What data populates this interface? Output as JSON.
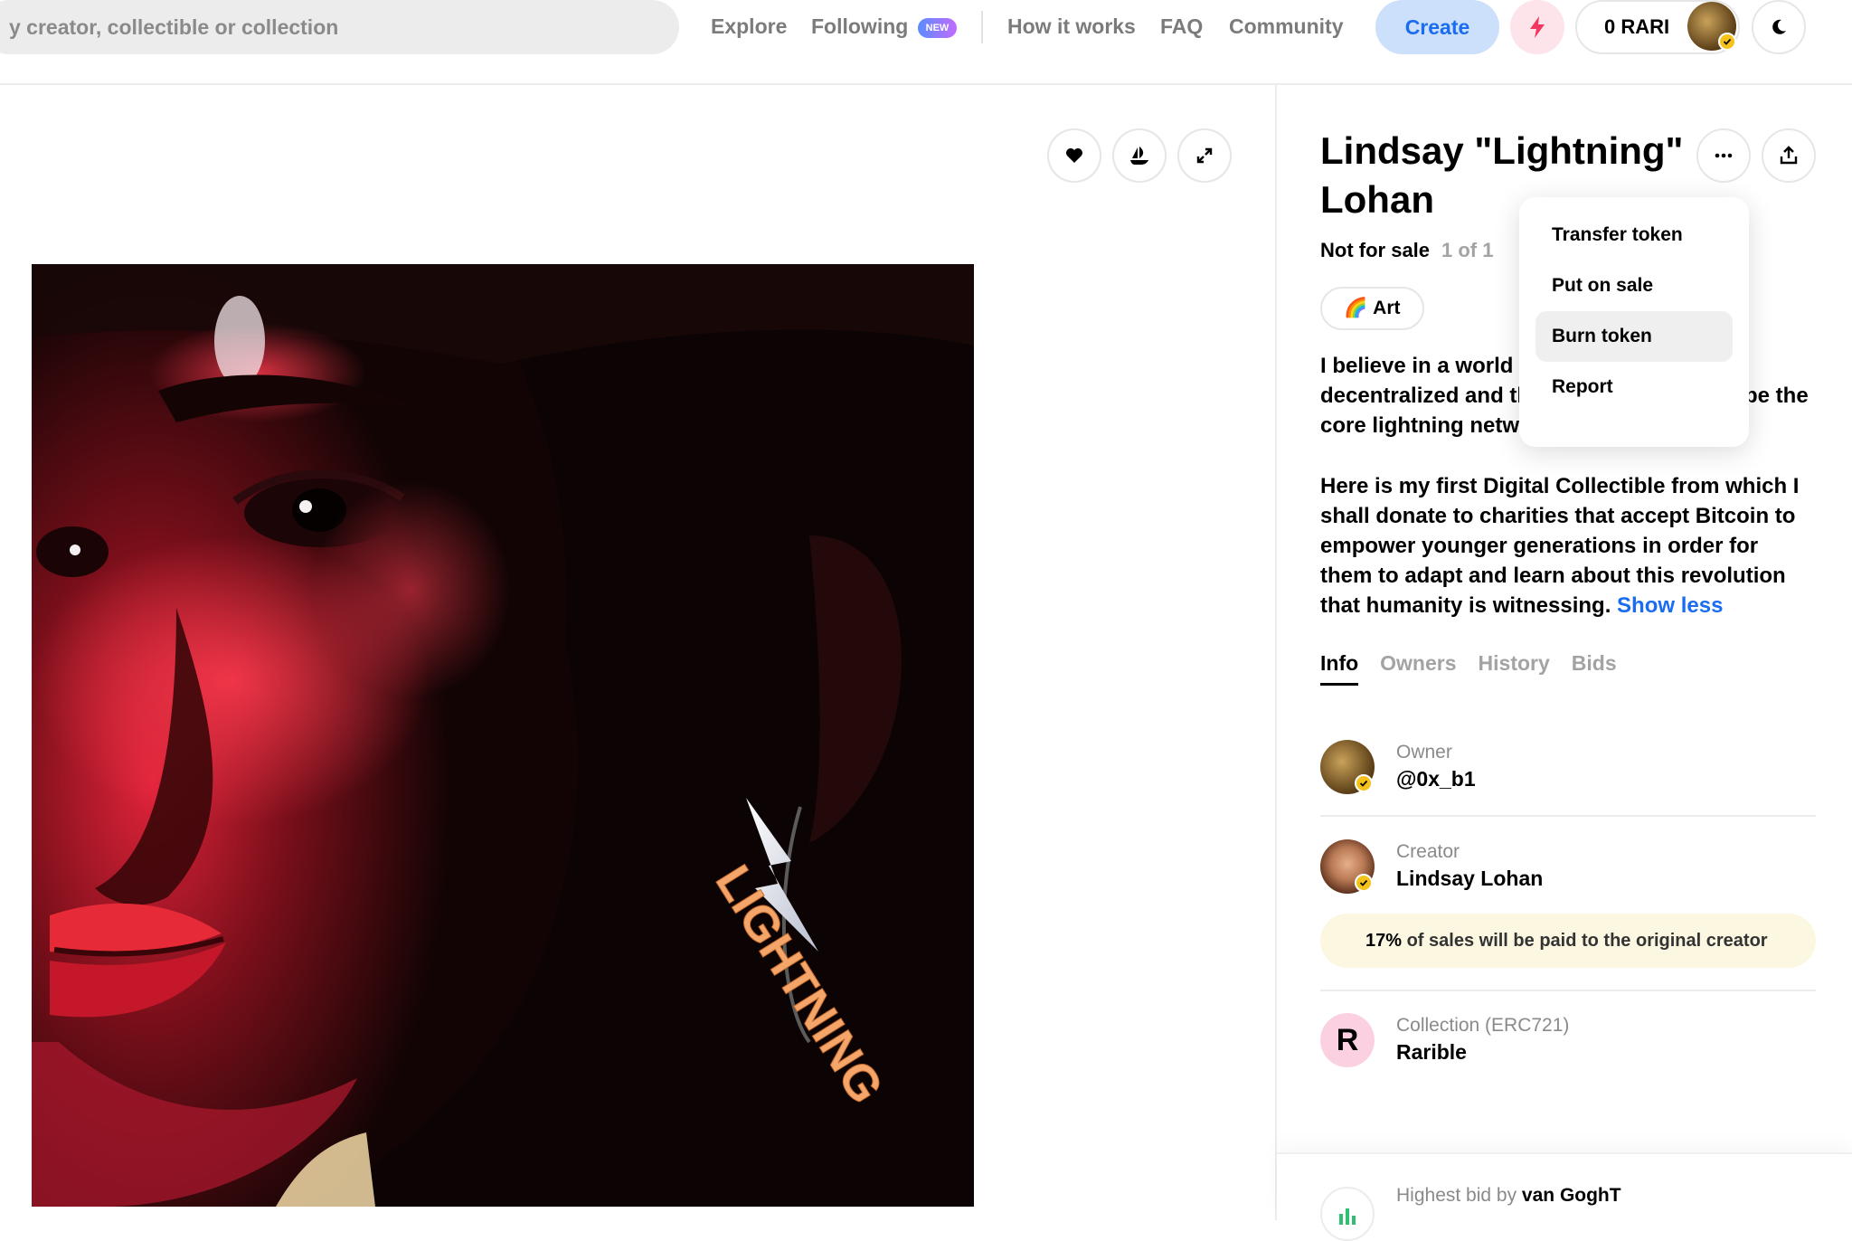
{
  "header": {
    "search_placeholder": "y creator, collectible or collection",
    "nav": {
      "explore": "Explore",
      "following": "Following",
      "following_badge": "NEW",
      "how_it_works": "How it works",
      "faq": "FAQ",
      "community": "Community"
    },
    "create_label": "Create",
    "balance": "0 RARI",
    "icons": [
      "lightning-icon",
      "moon-icon"
    ],
    "accent_color": "#1a6cf0"
  },
  "media_actions": [
    "heart-icon",
    "opensea-sailboat-icon",
    "expand-icon"
  ],
  "item": {
    "title": "Lindsay \"Lightning\" Lohan",
    "sale_status": "Not for sale",
    "edition": "1 of 1",
    "tag_emoji": "🌈",
    "tag_label": "Art",
    "description_p1_line1": "I believe in a world w",
    "description_p1_line2": "decentralized and th",
    "description_p1_line2_tail": "be the",
    "description_p1_line3": "core lightning netwo",
    "description_p2": "Here is my first Digital Collectible from which I shall donate to charities that accept Bitcoin to empower younger generations in order for them to adapt and learn about this revolution that humanity is witnessing.",
    "show_less": "Show less"
  },
  "tabs": [
    {
      "label": "Info",
      "active": true
    },
    {
      "label": "Owners",
      "active": false
    },
    {
      "label": "History",
      "active": false
    },
    {
      "label": "Bids",
      "active": false
    }
  ],
  "info": {
    "owner_role": "Owner",
    "owner_name": "@0x_b1",
    "creator_role": "Creator",
    "creator_name": "Lindsay Lohan",
    "royalty_percent": "17%",
    "royalty_text": "of sales will be paid to the original creator",
    "collection_role": "Collection (ERC721)",
    "collection_name": "Rarible",
    "collection_logo": "R"
  },
  "bid": {
    "label": "Highest bid by",
    "bidder": "van GoghT"
  },
  "menu": {
    "items": [
      "Transfer token",
      "Put on sale",
      "Burn token",
      "Report"
    ],
    "highlighted": "Burn token"
  },
  "artwork": {
    "earring_text": "LIGHTNING"
  }
}
